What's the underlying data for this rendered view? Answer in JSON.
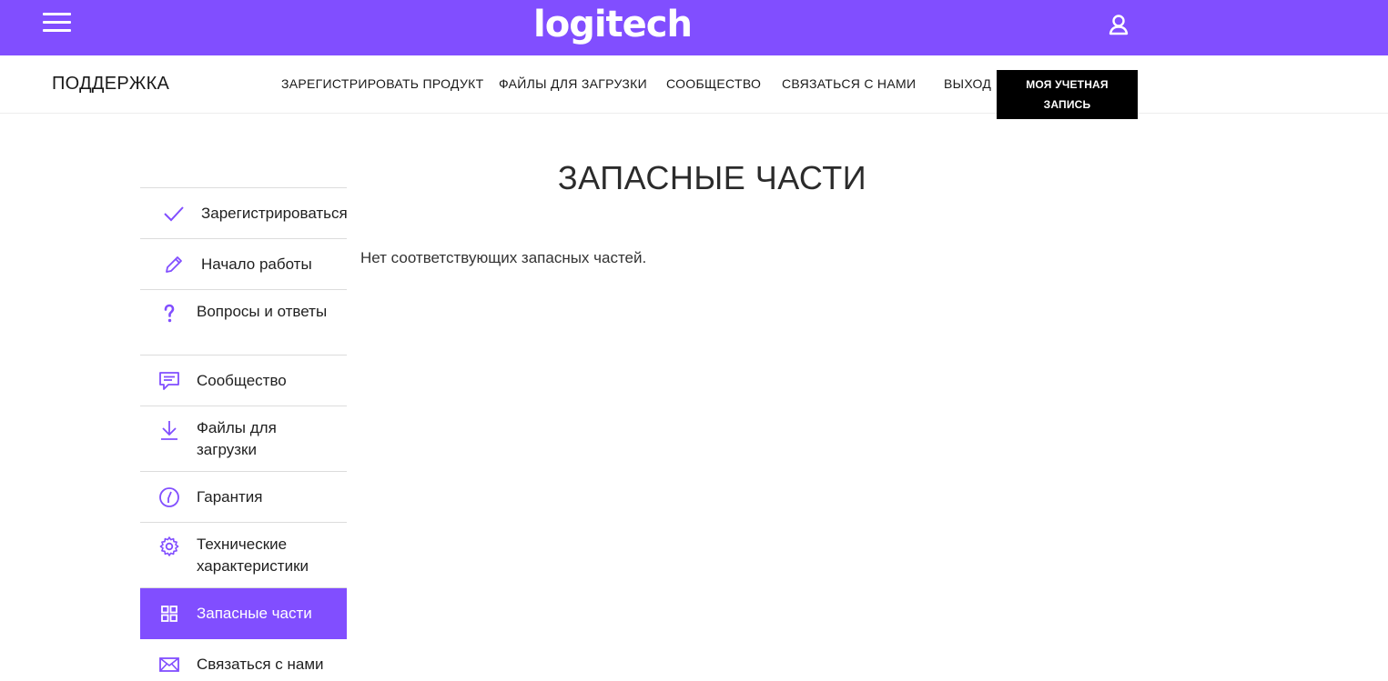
{
  "header": {
    "logo_text": "logitech",
    "brand_color": "#814eff"
  },
  "subnav": {
    "brand": "ПОДДЕРЖКА",
    "links": [
      "ЗАРЕГИСТРИРОВАТЬ ПРОДУКТ",
      "ФАЙЛЫ ДЛЯ ЗАГРУЗКИ",
      "СООБЩЕСТВО",
      "СВЯЗАТЬСЯ С НАМИ",
      "ВЫХОД"
    ],
    "account_line1": "МОЯ УЧЕТНАЯ",
    "account_line2": "ЗАПИСЬ"
  },
  "main": {
    "title": "ЗАПАСНЫЕ ЧАСТИ",
    "empty_message": "Нет соответствующих запасных частей."
  },
  "sidebar": {
    "items": [
      {
        "label": "Зарегистрироваться",
        "icon": "checkmark-icon"
      },
      {
        "label": "Начало работы",
        "icon": "pencil-icon"
      },
      {
        "label": "Вопросы и ответы",
        "icon": "question-icon"
      },
      {
        "label": "Сообщество",
        "icon": "chat-icon"
      },
      {
        "label": "Файлы для загрузки",
        "icon": "download-icon"
      },
      {
        "label": "Гарантия",
        "icon": "warranty-clock-icon"
      },
      {
        "label": "Технические характеристики",
        "icon": "gear-icon"
      },
      {
        "label": "Запасные части",
        "icon": "grid-icon",
        "active": true
      },
      {
        "label": "Связаться с нами",
        "icon": "envelope-icon"
      }
    ]
  }
}
